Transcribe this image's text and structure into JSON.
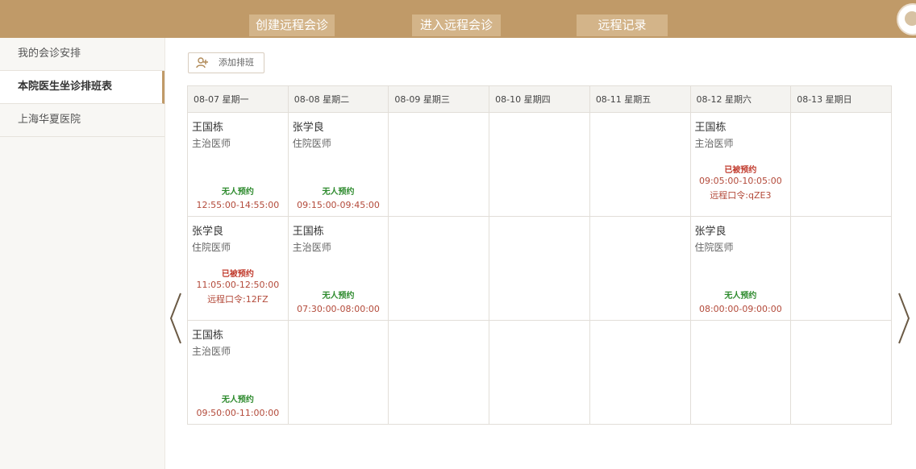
{
  "top_tabs": [
    {
      "label": "创建远程会诊"
    },
    {
      "label": "进入远程会诊"
    },
    {
      "label": "远程记录"
    }
  ],
  "sidebar": {
    "items": [
      {
        "label": "我的会诊安排",
        "active": false
      },
      {
        "label": "本院医生坐诊排班表",
        "active": true
      },
      {
        "label": "上海华夏医院",
        "active": false
      }
    ]
  },
  "toolbar": {
    "add_label": "添加排班",
    "add_icon": "add-user-icon"
  },
  "schedule": {
    "days": [
      "08-07 星期一",
      "08-08 星期二",
      "08-09 星期三",
      "08-10 星期四",
      "08-11 星期五",
      "08-12 星期六",
      "08-13 星期日"
    ],
    "rows": [
      [
        {
          "name": "王国栋",
          "title": "主治医师",
          "status": "无人预约",
          "time": "12:55:00-14:55:00"
        },
        {
          "name": "张学良",
          "title": "住院医师",
          "status": "无人预约",
          "time": "09:15:00-09:45:00"
        },
        null,
        null,
        null,
        {
          "name": "王国栋",
          "title": "主治医师",
          "status": "已被预约",
          "time": "09:05:00-10:05:00",
          "code": "远程口令:qZE3"
        },
        null
      ],
      [
        {
          "name": "张学良",
          "title": "住院医师",
          "status": "已被预约",
          "time": "11:05:00-12:50:00",
          "code": "远程口令:12FZ"
        },
        {
          "name": "王国栋",
          "title": "主治医师",
          "status": "无人预约",
          "time": "07:30:00-08:00:00"
        },
        null,
        null,
        null,
        {
          "name": "张学良",
          "title": "住院医师",
          "status": "无人预约",
          "time": "08:00:00-09:00:00"
        },
        null
      ],
      [
        {
          "name": "王国栋",
          "title": "主治医师",
          "status": "无人预约",
          "time": "09:50:00-11:00:00"
        },
        null,
        null,
        null,
        null,
        null,
        null
      ]
    ]
  },
  "colors": {
    "accent": "#c09a68",
    "free": "#2e8b2e",
    "booked": "#c0392b"
  }
}
